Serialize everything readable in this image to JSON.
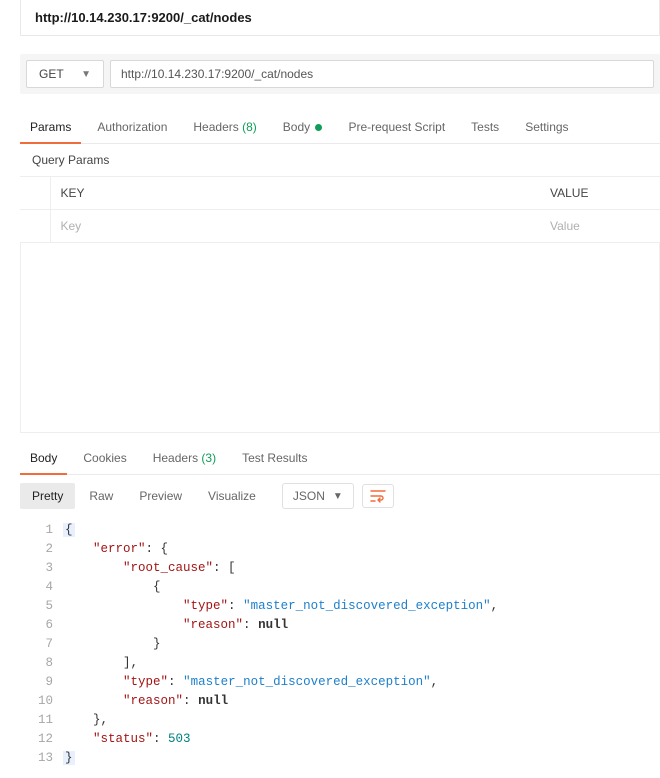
{
  "title": "http://10.14.230.17:9200/_cat/nodes",
  "request": {
    "method": "GET",
    "url": "http://10.14.230.17:9200/_cat/nodes"
  },
  "request_tabs": {
    "params": "Params",
    "authorization": "Authorization",
    "headers": "Headers",
    "headers_count": "(8)",
    "body": "Body",
    "prerequest": "Pre-request Script",
    "tests": "Tests",
    "settings": "Settings"
  },
  "query_params": {
    "section_label": "Query Params",
    "col_key": "KEY",
    "col_value": "VALUE",
    "placeholder_key": "Key",
    "placeholder_value": "Value"
  },
  "response_tabs": {
    "body": "Body",
    "cookies": "Cookies",
    "headers": "Headers",
    "headers_count": "(3)",
    "test_results": "Test Results"
  },
  "response_view": {
    "pretty": "Pretty",
    "raw": "Raw",
    "preview": "Preview",
    "visualize": "Visualize",
    "format": "JSON"
  },
  "response_lines": {
    "l1": "{",
    "l2a": "    \"error\"",
    "l2b": ": {",
    "l3a": "        \"root_cause\"",
    "l3b": ": [",
    "l4": "            {",
    "l5a": "                \"type\"",
    "l5b": ": ",
    "l5c": "\"master_not_discovered_exception\"",
    "l5d": ",",
    "l6a": "                \"reason\"",
    "l6b": ": ",
    "l6c": "null",
    "l7": "            }",
    "l8": "        ],",
    "l9a": "        \"type\"",
    "l9b": ": ",
    "l9c": "\"master_not_discovered_exception\"",
    "l9d": ",",
    "l10a": "        \"reason\"",
    "l10b": ": ",
    "l10c": "null",
    "l11": "    },",
    "l12a": "    \"status\"",
    "l12b": ": ",
    "l12c": "503",
    "l13": "}"
  },
  "line_numbers": [
    "1",
    "2",
    "3",
    "4",
    "5",
    "6",
    "7",
    "8",
    "9",
    "10",
    "11",
    "12",
    "13"
  ]
}
